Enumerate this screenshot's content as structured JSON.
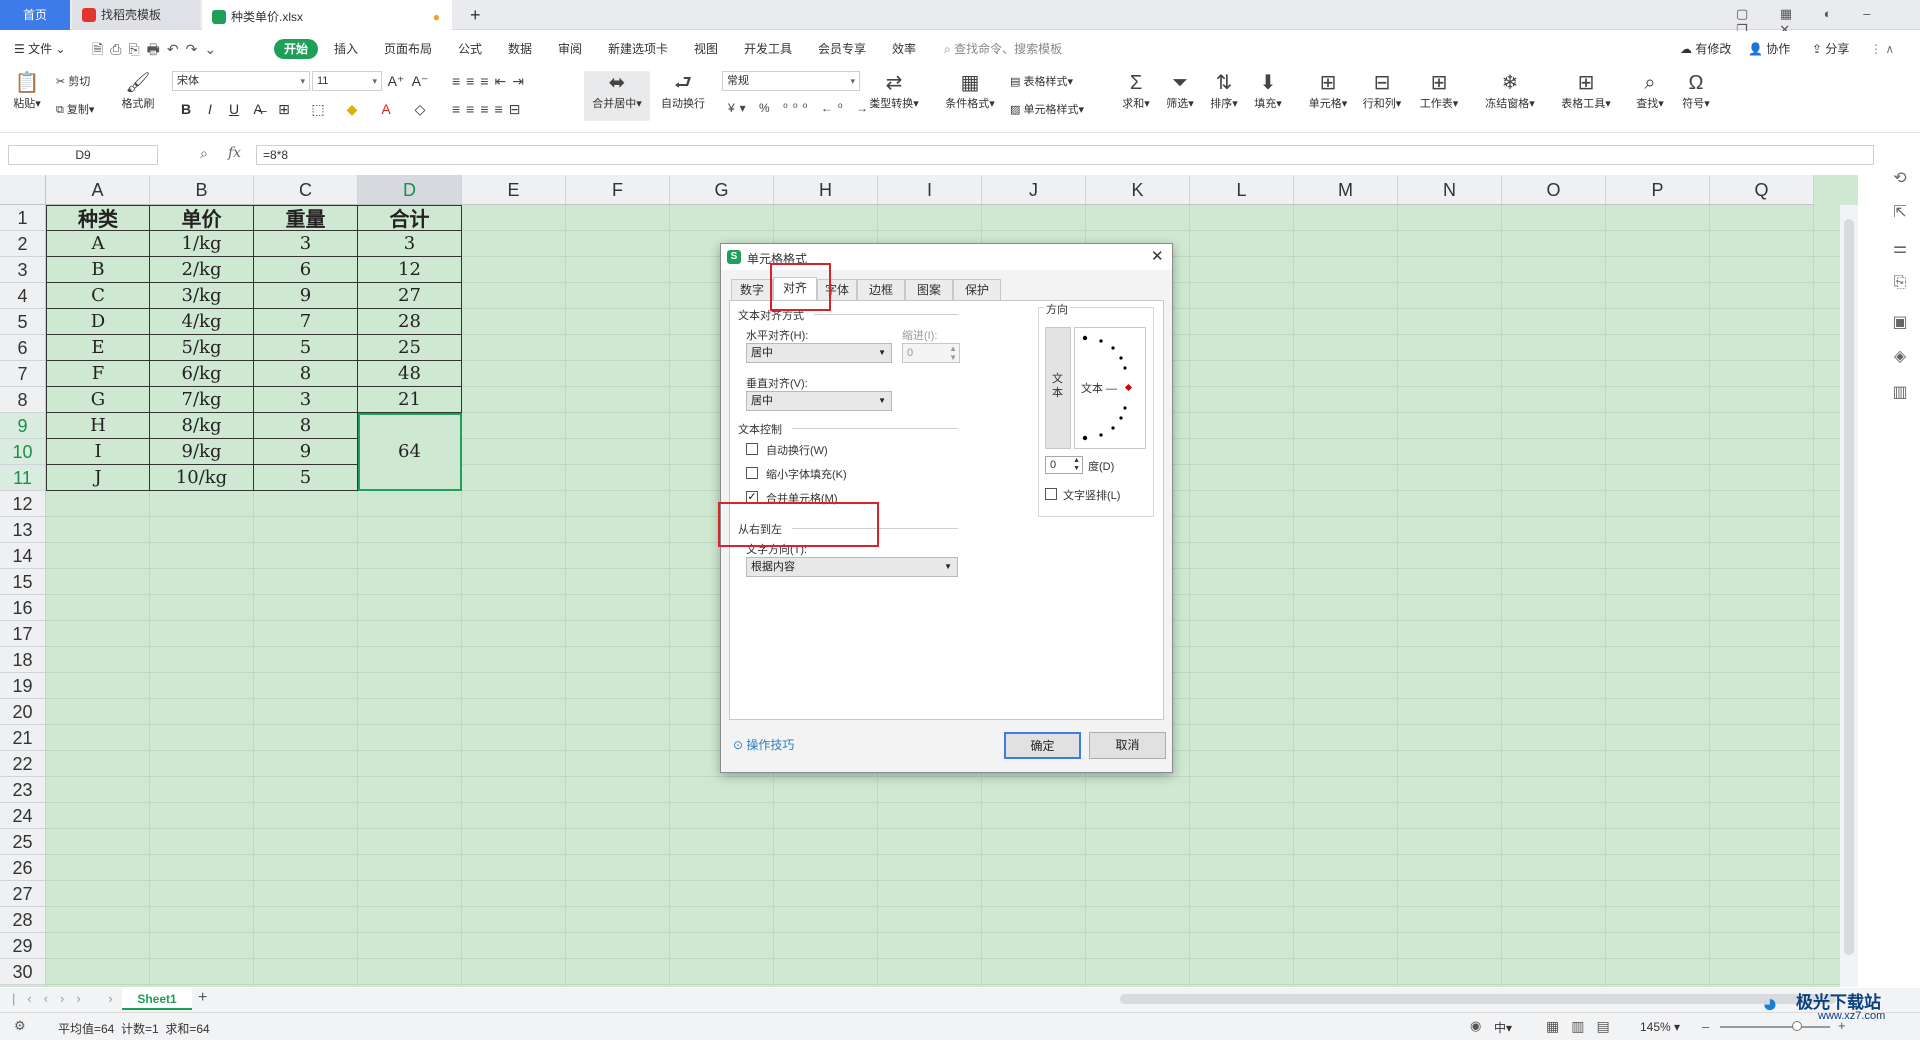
{
  "tabs": {
    "home": "首页",
    "template": "找稻壳模板",
    "file": "种类单价.xlsx",
    "new_tab": "+"
  },
  "menu": {
    "file": "文件",
    "items": [
      "开始",
      "插入",
      "页面布局",
      "公式",
      "数据",
      "审阅",
      "新建选项卡",
      "视图",
      "开发工具",
      "会员专享",
      "效率"
    ],
    "search": "查找命令、搜索模板",
    "right": [
      "有修改",
      "协作",
      "分享"
    ]
  },
  "ribbon": {
    "paste": "粘贴",
    "cut": "剪切",
    "copy": "复制",
    "format_painter": "格式刷",
    "font_name": "宋体",
    "font_size": "11",
    "merge": "合并居中",
    "wrap": "自动换行",
    "number_format": "常规",
    "type_convert": "类型转换",
    "conditional": "条件格式",
    "table_style": "表格样式",
    "cell_style": "单元格样式",
    "sum": "求和",
    "filter": "筛选",
    "sort": "排序",
    "fill": "填充",
    "cells": "单元格",
    "row_col": "行和列",
    "worksheet": "工作表",
    "freeze": "冻结窗格",
    "table_tools": "表格工具",
    "find": "查找",
    "symbol": "符号"
  },
  "formula": {
    "name_box": "D9",
    "fx": "fx",
    "content": "=8*8"
  },
  "columns": [
    "A",
    "B",
    "C",
    "D",
    "E",
    "F",
    "G",
    "H",
    "I",
    "J",
    "K",
    "L",
    "M",
    "N",
    "O",
    "P",
    "Q"
  ],
  "rows": [
    "1",
    "2",
    "3",
    "4",
    "5",
    "6",
    "7",
    "8",
    "9",
    "10",
    "11",
    "12",
    "13",
    "14",
    "15",
    "16",
    "17",
    "18",
    "19",
    "20",
    "21",
    "22",
    "23",
    "24",
    "25",
    "26",
    "27",
    "28",
    "29",
    "30"
  ],
  "table": {
    "headers": [
      "种类",
      "单价",
      "重量",
      "合计"
    ],
    "rows": [
      [
        "A",
        "1/kg",
        "3",
        "3"
      ],
      [
        "B",
        "2/kg",
        "6",
        "12"
      ],
      [
        "C",
        "3/kg",
        "9",
        "27"
      ],
      [
        "D",
        "4/kg",
        "7",
        "28"
      ],
      [
        "E",
        "5/kg",
        "5",
        "25"
      ],
      [
        "F",
        "6/kg",
        "8",
        "48"
      ],
      [
        "G",
        "7/kg",
        "3",
        "21"
      ],
      [
        "H",
        "8/kg",
        "8",
        ""
      ],
      [
        "I",
        "9/kg",
        "9",
        ""
      ],
      [
        "J",
        "10/kg",
        "5",
        ""
      ]
    ],
    "merged_value": "64"
  },
  "dialog": {
    "title": "单元格格式",
    "tabs": [
      "数字",
      "对齐",
      "字体",
      "边框",
      "图案",
      "保护"
    ],
    "text_align_section": "文本对齐方式",
    "horizontal_label": "水平对齐(H):",
    "horizontal_value": "居中",
    "indent_label": "缩进(I):",
    "indent_value": "0",
    "vertical_label": "垂直对齐(V):",
    "vertical_value": "居中",
    "text_control_section": "文本控制",
    "wrap_text": "自动换行(W)",
    "shrink_fit": "缩小字体填充(K)",
    "merge_cells": "合并单元格(M)",
    "rtl_section": "从右到左",
    "text_direction_label": "文字方向(T):",
    "text_direction_value": "根据内容",
    "orientation_section": "方向",
    "vertical_text": "文本",
    "orientation_text": "文本 —",
    "degree_value": "0",
    "degree_label": "度(D)",
    "vertical_stack": "文字竖排(L)",
    "tips": "操作技巧",
    "ok": "确定",
    "cancel": "取消"
  },
  "sheet_tab": "Sheet1",
  "status": {
    "summary": "平均值=64  计数=1  求和=64",
    "zoom": "145%",
    "lang": "中"
  },
  "watermark": {
    "name": "极光下载站",
    "url": "www.xz7.com"
  }
}
